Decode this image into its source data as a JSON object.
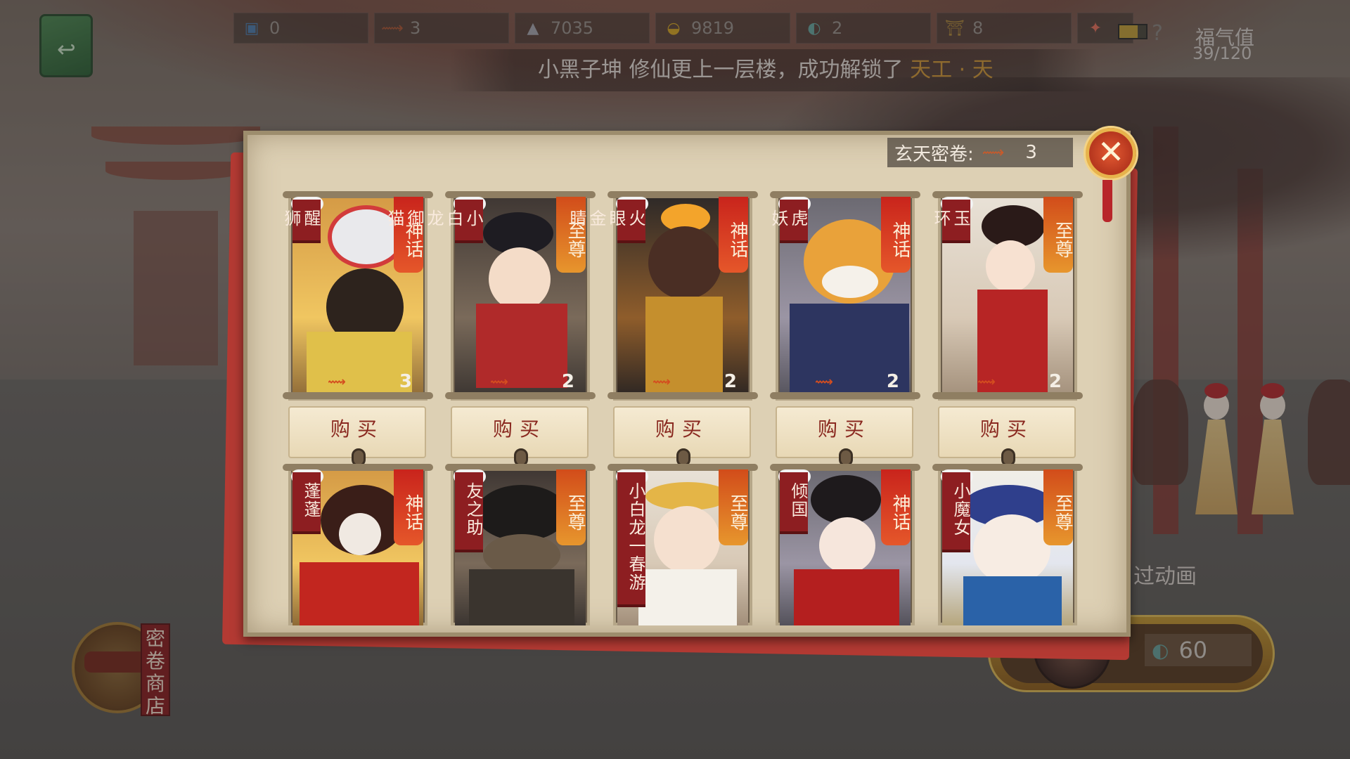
{
  "topbar": {
    "resources": [
      {
        "icon": "ticket-icon",
        "value": "0"
      },
      {
        "icon": "scroll-icon",
        "value": "3"
      },
      {
        "icon": "boot-icon",
        "value": "7035"
      },
      {
        "icon": "gold-ingot-icon",
        "value": "9819"
      },
      {
        "icon": "jade-icon",
        "value": "2"
      },
      {
        "icon": "gate-icon",
        "value": "8"
      },
      {
        "icon": "sparkle-icon",
        "value": ""
      }
    ],
    "luck_label": "福气值",
    "luck_value": "39/120"
  },
  "announcement": {
    "prefix": "小黑子坤 修仙更上一层楼，成功解锁了",
    "highlight": "天工 · 天"
  },
  "modal": {
    "balance_label": "玄天密卷:",
    "balance_value": "3",
    "close_icon": "close-icon",
    "buy_label": "购买",
    "cards": [
      {
        "name": "醒狮",
        "rarity": "神话",
        "qty": "3"
      },
      {
        "name": "小白龙御猫",
        "rarity": "至尊",
        "qty": "2"
      },
      {
        "name": "火眼金睛",
        "rarity": "神话",
        "qty": "2"
      },
      {
        "name": "虎妖",
        "rarity": "神话",
        "qty": "2"
      },
      {
        "name": "玉环",
        "rarity": "至尊",
        "qty": "2"
      },
      {
        "name": "蓬蓬",
        "rarity": "神话",
        "qty": ""
      },
      {
        "name": "友之助",
        "rarity": "至尊",
        "qty": ""
      },
      {
        "name": "小白龙一春游",
        "rarity": "至尊",
        "qty": ""
      },
      {
        "name": "倾国",
        "rarity": "神话",
        "qty": ""
      },
      {
        "name": "小魔女",
        "rarity": "至尊",
        "qty": ""
      }
    ]
  },
  "bottom": {
    "shop_label": "密卷商店",
    "animation_label": "过动画",
    "claim_cost": "60"
  },
  "colors": {
    "mythic": "#c9241c",
    "supreme": "#d24c1a",
    "panel": "#ddd0b4",
    "buy_text": "#8a2920"
  }
}
